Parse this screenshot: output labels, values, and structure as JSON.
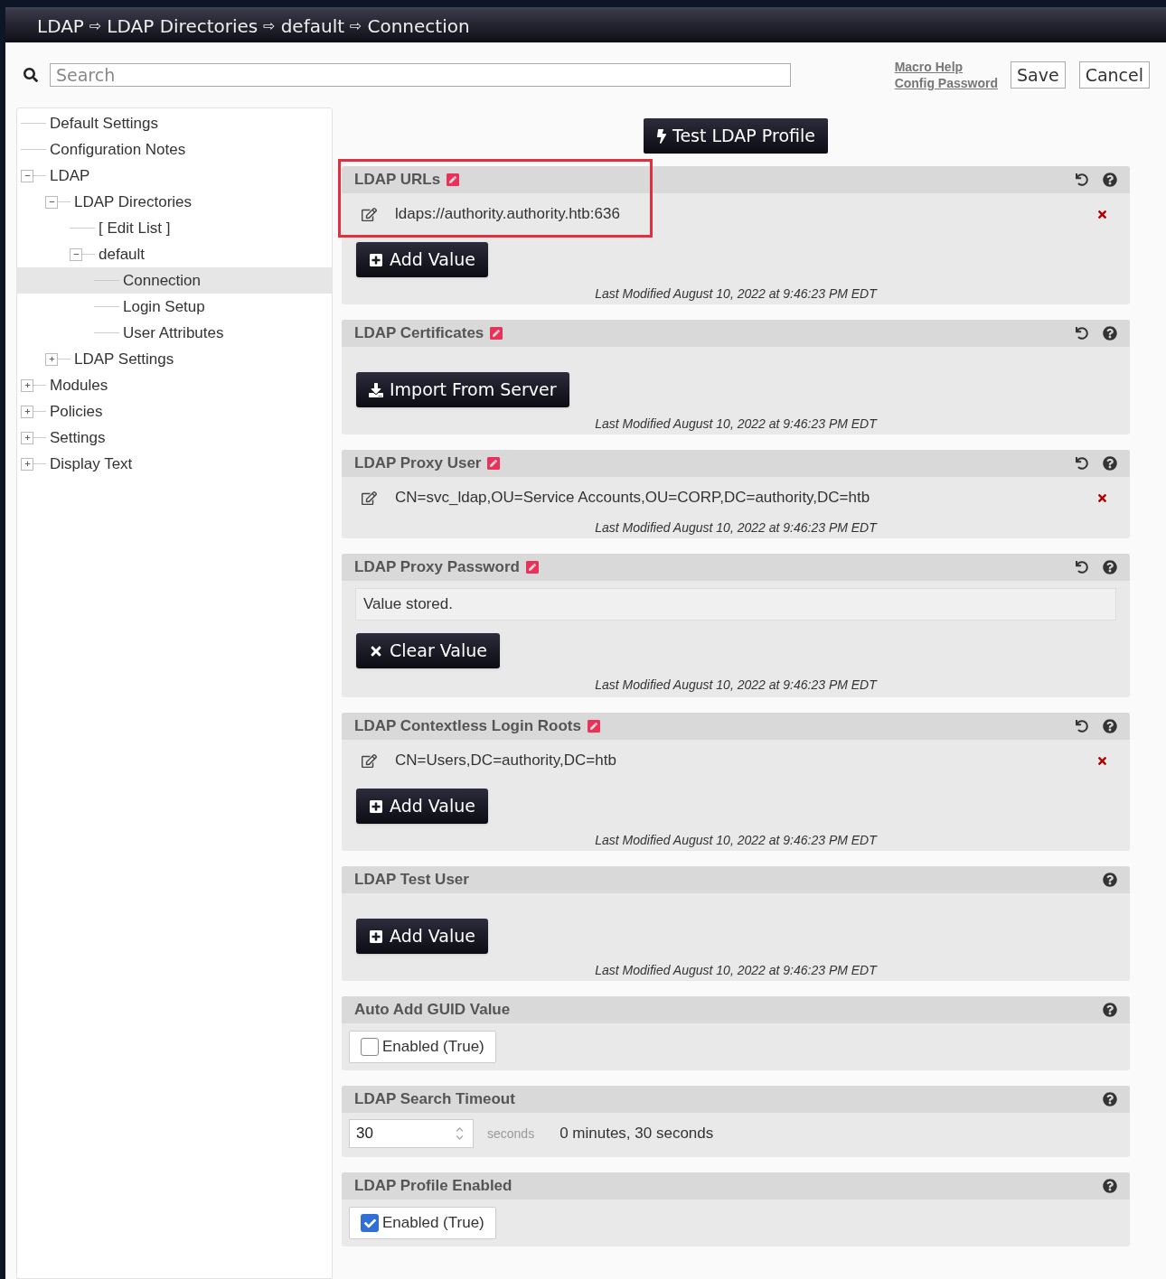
{
  "breadcrumb": [
    "LDAP",
    "LDAP Directories",
    "default",
    "Connection"
  ],
  "breadcrumb_separator": "⇨",
  "search": {
    "placeholder": "Search"
  },
  "links": [
    "Macro Help",
    "Config Password"
  ],
  "buttons": [
    "Save",
    "Cancel"
  ],
  "tree": [
    {
      "label": "Default Settings",
      "selected": false
    },
    {
      "label": "Configuration Notes",
      "selected": false
    },
    {
      "label": "LDAP",
      "selected": false,
      "expanded": true,
      "children": [
        {
          "label": "LDAP Directories",
          "selected": false,
          "expanded": true,
          "children": [
            {
              "label": "[ Edit List ]",
              "selected": false
            },
            {
              "label": "default",
              "selected": false,
              "expanded": true,
              "children": [
                {
                  "label": "Connection",
                  "selected": true
                },
                {
                  "label": "Login Setup",
                  "selected": false
                },
                {
                  "label": "User Attributes",
                  "selected": false
                }
              ]
            }
          ]
        },
        {
          "label": "LDAP Settings",
          "selected": false,
          "expanded": false
        }
      ]
    },
    {
      "label": "Modules",
      "selected": false,
      "expanded": false
    },
    {
      "label": "Policies",
      "selected": false,
      "expanded": false
    },
    {
      "label": "Settings",
      "selected": false,
      "expanded": false
    },
    {
      "label": "Display Text",
      "selected": false,
      "expanded": false
    }
  ],
  "test_button": "Test LDAP Profile",
  "panels": [
    {
      "kind": "values",
      "title": "LDAP URLs",
      "modified": true,
      "resettable": true,
      "highlighted": true,
      "values": [
        "ldaps://authority.authority.htb:636"
      ],
      "button": "Add Value",
      "last_modified": "Last Modified August 10, 2022 at 9:46:23 PM EDT"
    },
    {
      "kind": "import",
      "title": "LDAP Certificates",
      "modified": true,
      "resettable": true,
      "highlighted": false,
      "button": "Import From Server",
      "last_modified": "Last Modified August 10, 2022 at 9:46:23 PM EDT"
    },
    {
      "kind": "values",
      "title": "LDAP Proxy User",
      "modified": true,
      "resettable": true,
      "highlighted": false,
      "values": [
        "CN=svc_ldap,OU=Service Accounts,OU=CORP,DC=authority,DC=htb"
      ],
      "last_modified": "Last Modified August 10, 2022 at 9:46:23 PM EDT"
    },
    {
      "kind": "stored",
      "title": "LDAP Proxy Password",
      "modified": true,
      "resettable": true,
      "highlighted": false,
      "stored_text": "Value stored.",
      "button": "Clear Value",
      "last_modified": "Last Modified August 10, 2022 at 9:46:23 PM EDT"
    },
    {
      "kind": "values",
      "title": "LDAP Contextless Login Roots",
      "modified": true,
      "resettable": true,
      "highlighted": false,
      "values": [
        "CN=Users,DC=authority,DC=htb"
      ],
      "button": "Add Value",
      "last_modified": "Last Modified August 10, 2022 at 9:46:23 PM EDT"
    },
    {
      "kind": "values",
      "title": "LDAP Test User",
      "modified": false,
      "resettable": false,
      "highlighted": false,
      "button": "Add Value",
      "last_modified": "Last Modified August 10, 2022 at 9:46:23 PM EDT"
    },
    {
      "kind": "checkbox",
      "title": "Auto Add GUID Value",
      "modified": false,
      "resettable": false,
      "highlighted": false,
      "label": "Enabled (True)",
      "checked": false
    },
    {
      "kind": "number",
      "title": "LDAP Search Timeout",
      "modified": false,
      "resettable": false,
      "highlighted": false,
      "value": "30",
      "unit": "seconds",
      "description": "0 minutes, 30 seconds"
    },
    {
      "kind": "checkbox",
      "title": "LDAP Profile Enabled",
      "modified": false,
      "resettable": false,
      "highlighted": false,
      "label": "Enabled (True)",
      "checked": true
    }
  ]
}
